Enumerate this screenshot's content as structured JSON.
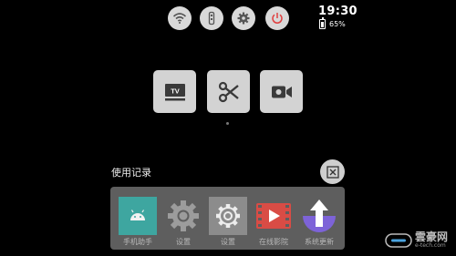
{
  "status": {
    "time": "19:30",
    "battery": "65%",
    "battery_level": 0.65
  },
  "quick_toggles": [
    "wifi-icon",
    "remote-icon",
    "gear-icon",
    "power-icon"
  ],
  "tiles": [
    {
      "icon": "tv-icon",
      "text": "TV"
    },
    {
      "icon": "scissors-icon"
    },
    {
      "icon": "video-camera-icon"
    }
  ],
  "recent": {
    "title": "使用记录",
    "apps": [
      {
        "label": "手机助手",
        "icon": "android-icon"
      },
      {
        "label": "设置",
        "icon": "gear-icon"
      },
      {
        "label": "设置",
        "icon": "gear-outline-icon"
      },
      {
        "label": "在线影院",
        "icon": "film-play-icon"
      },
      {
        "label": "系统更新",
        "icon": "upload-arrow-icon"
      }
    ]
  },
  "watermark": {
    "brand": "雲豪网",
    "url": "e-tech.com"
  },
  "colors": {
    "power_accent": "#e04040",
    "tile_bg": "#d3d3d3",
    "panel_bg": "#5e5e5e"
  }
}
